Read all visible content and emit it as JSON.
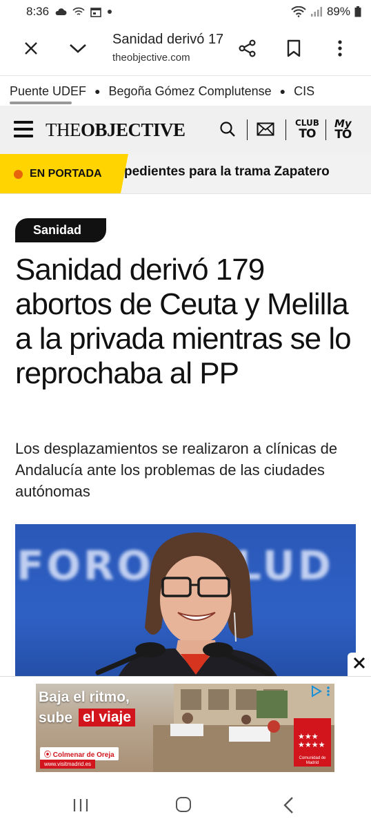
{
  "status_bar": {
    "time": "8:36",
    "battery": "89%",
    "icons": [
      "cloud-icon",
      "wifi-calling-icon",
      "calendar-icon",
      "dot-icon",
      "wifi-icon",
      "signal-icon",
      "battery-icon"
    ]
  },
  "custom_tab": {
    "title": "Sanidad derivó 179 abortos de Ceuta y Melilla a la privada mientras se lo reprochaba al PP",
    "url": "theobjective.com",
    "icons": [
      "close-icon",
      "chevron-down-icon",
      "share-icon",
      "bookmark-icon",
      "more-vert-icon"
    ]
  },
  "trending": {
    "items": [
      "Puente UDEF",
      "Begoña Gómez Complutense",
      "CIS"
    ]
  },
  "site_header": {
    "logo_light": "THE",
    "logo_bold": "OBJECTIVE",
    "club_top": "CLUB",
    "club_bottom": "TO",
    "my_top": "My",
    "my_bottom": "TO"
  },
  "breaking": {
    "label": "EN PORTADA",
    "text": "pedientes para la trama Zapatero"
  },
  "article": {
    "section": "Sanidad",
    "headline": "Sanidad derivó 179 abortos de Ceuta y Melilla a la privada mientras se lo reprochaba al PP",
    "subheadline": "Los desplazamientos se realizaron a clínicas de Andalucía ante los problemas de las ciudades autónomas",
    "photo_backdrop_text": "FORO SALUD"
  },
  "ad": {
    "line1": "Baja el ritmo,",
    "line2_prefix": "sube",
    "line2_highlight": "el viaje",
    "location": "Colmenar de Oreja",
    "url": "www.visitmadrid.es",
    "logo_text": "Comunidad de Madrid"
  },
  "colors": {
    "accent_yellow": "#ffd400",
    "breaking_dot": "#e8640c",
    "ad_red": "#d2141c",
    "photo_blue": "#2e60c4"
  }
}
